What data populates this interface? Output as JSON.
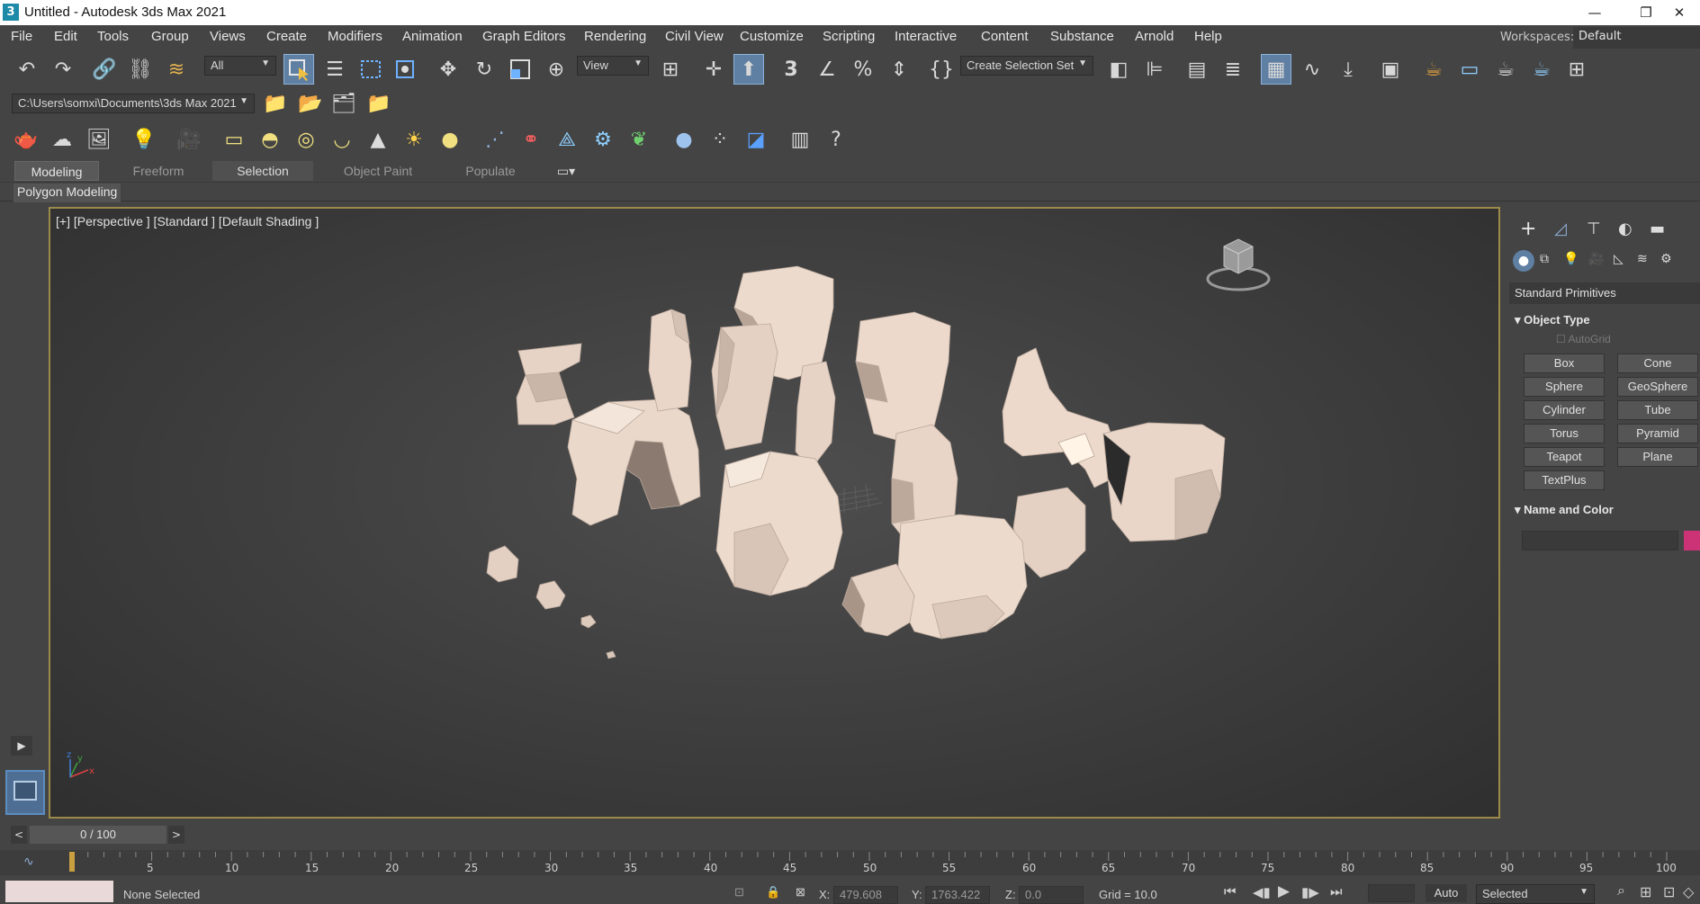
{
  "window": {
    "title": "Untitled - Autodesk 3ds Max 2021",
    "app_icon": "3",
    "minimize": "—",
    "restore": "❐",
    "close": "✕"
  },
  "menu": [
    "File",
    "Edit",
    "Tools",
    "Group",
    "Views",
    "Create",
    "Modifiers",
    "Animation",
    "Graph Editors",
    "Rendering",
    "Civil View",
    "Customize",
    "Scripting",
    "Interactive",
    "Content",
    "Substance",
    "Arnold",
    "Help"
  ],
  "workspaces": {
    "label": "Workspaces:",
    "value": "Default"
  },
  "toolbar": {
    "selection_filter": "All",
    "ref_coord": "View",
    "named_selection": "Create Selection Set",
    "snap_label": "3",
    "project_path": "C:\\Users\\somxi\\Documents\\3ds Max 2021"
  },
  "ribbon": {
    "tabs": [
      "Modeling",
      "Freeform",
      "Selection",
      "Object Paint",
      "Populate"
    ],
    "panel_label": "Polygon Modeling"
  },
  "viewport": {
    "label": "[+] [Perspective ] [Standard ] [Default Shading ]",
    "axis_x": "x",
    "axis_y": "y",
    "axis_z": "z"
  },
  "command_panel": {
    "category": "Standard Primitives",
    "object_type_title": "Object Type",
    "autogrid": "AutoGrid",
    "buttons": [
      "Box",
      "Cone",
      "Sphere",
      "GeoSphere",
      "Cylinder",
      "Tube",
      "Torus",
      "Pyramid",
      "Teapot",
      "Plane",
      "TextPlus"
    ],
    "name_color_title": "Name and Color",
    "color": "#cc3377"
  },
  "timeline": {
    "frame": "0 / 100",
    "ticks": [
      "5",
      "10",
      "15",
      "20",
      "25",
      "30",
      "35",
      "40",
      "45",
      "50",
      "55",
      "60",
      "65",
      "70",
      "75",
      "80",
      "85",
      "90",
      "95",
      "100"
    ]
  },
  "status": {
    "selection": "None Selected",
    "x_label": "X:",
    "x_value": "479.608",
    "y_label": "Y:",
    "y_value": "1763.422",
    "z_label": "Z:",
    "z_value": "0.0",
    "grid": "Grid = 10.0",
    "auto_key": "Auto",
    "key_filter": "Selected"
  },
  "colors": {
    "background": "#444444",
    "viewport_border": "#9c8a4a",
    "active_tool": "#5f7fa3",
    "rock": "#e2cfc2"
  }
}
